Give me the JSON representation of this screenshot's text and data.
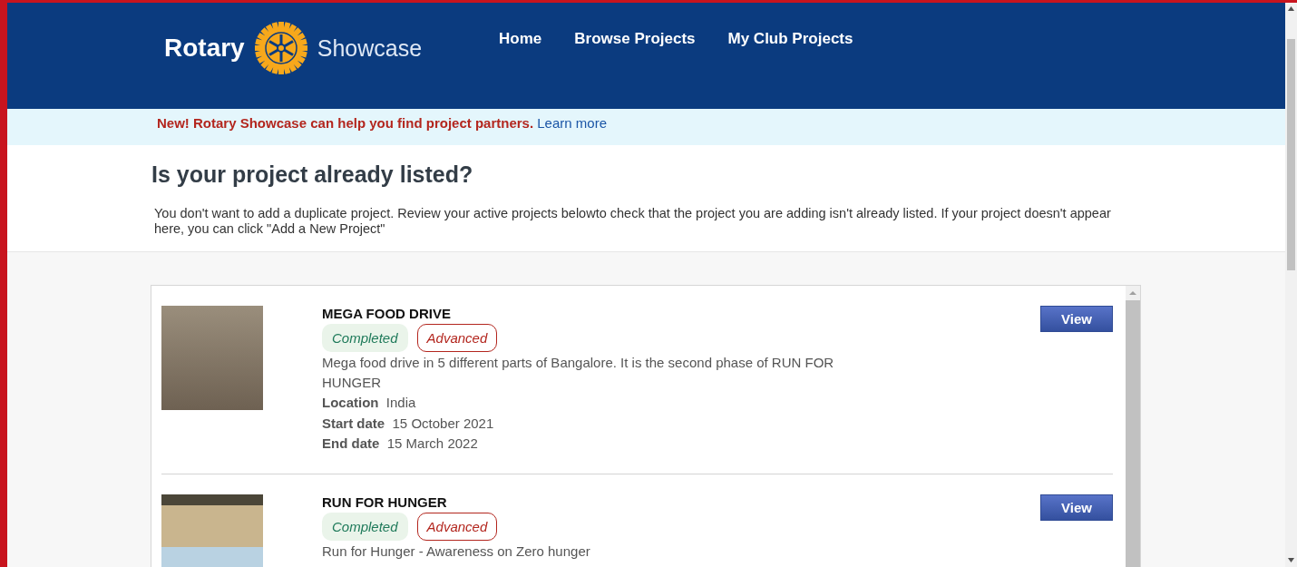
{
  "header": {
    "logo_text": "Rotary",
    "logo_suffix": "Showcase",
    "nav": [
      {
        "label": "Home"
      },
      {
        "label": "Browse Projects"
      },
      {
        "label": "My Club Projects"
      }
    ]
  },
  "banner": {
    "message": "New! Rotary Showcase can help you find project partners.",
    "link": "Learn more"
  },
  "intro": {
    "title": "Is your project already listed?",
    "text": "You don't want to add a duplicate project. Review your active projects belowto check that the project you are adding isn't already listed. If your project doesn't appear here, you can click \"Add a New Project\""
  },
  "projects": [
    {
      "title": "MEGA FOOD DRIVE",
      "tags": [
        {
          "kind": "status",
          "label": "Completed"
        },
        {
          "kind": "level",
          "label": "Advanced"
        }
      ],
      "description": "Mega food drive in 5 different parts of Bangalore. It is the second phase of RUN FOR HUNGER",
      "fields": [
        {
          "label": "Location",
          "value": "India"
        },
        {
          "label": "Start date",
          "value": "15 October 2021"
        },
        {
          "label": "End date",
          "value": "15 March 2022"
        }
      ],
      "button": "View"
    },
    {
      "title": "RUN FOR HUNGER",
      "tags": [
        {
          "kind": "status",
          "label": "Completed"
        },
        {
          "kind": "level",
          "label": "Advanced"
        }
      ],
      "description": "Run for Hunger - Awareness on Zero hunger",
      "button": "View"
    }
  ]
}
